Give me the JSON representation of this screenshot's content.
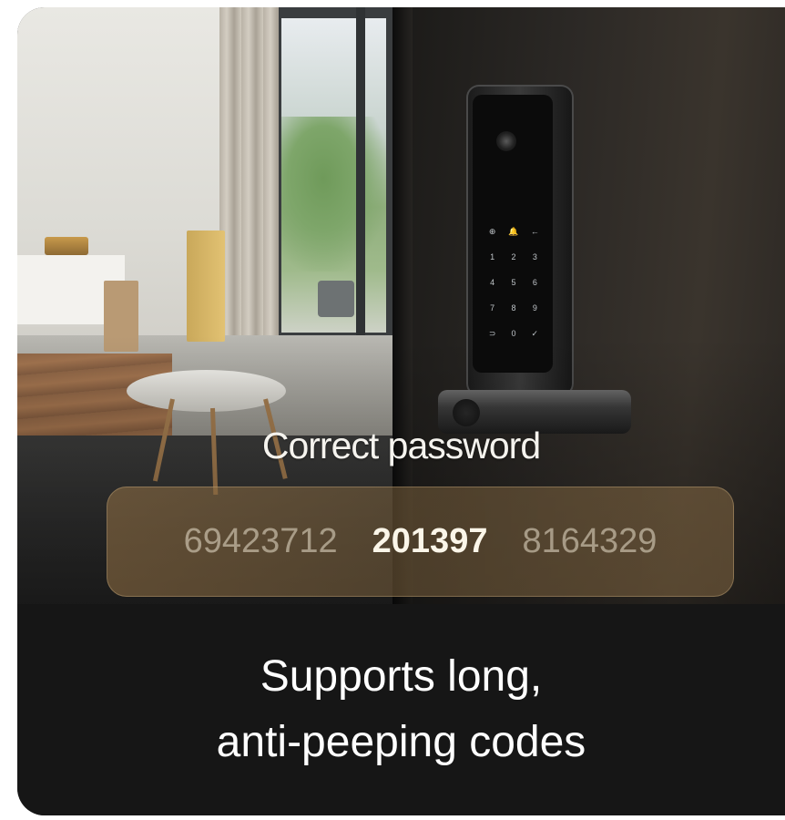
{
  "overlay": {
    "status": "Correct password",
    "codes": [
      "69423712",
      "201397",
      "8164329"
    ],
    "active_code_index": 1
  },
  "keypad": {
    "keys": [
      "⊕",
      "🔔",
      "←",
      "1",
      "2",
      "3",
      "4",
      "5",
      "6",
      "7",
      "8",
      "9",
      "⊃",
      "0",
      "✓"
    ]
  },
  "caption": {
    "line1": "Supports long,",
    "line2": "anti-peeping codes"
  },
  "colors": {
    "caption_bg": "#161616",
    "code_bar": "#8c6f48",
    "active_code": "#fbf6e9"
  }
}
